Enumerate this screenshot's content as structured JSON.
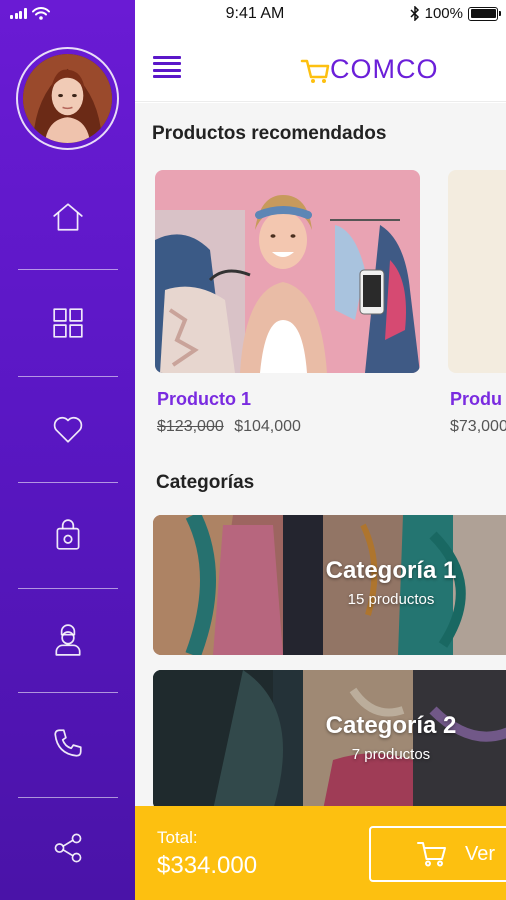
{
  "status_bar": {
    "time": "9:41 AM",
    "battery": "100%",
    "battery_level": 1.0
  },
  "sidebar": {
    "items": [
      {
        "icon": "home-icon"
      },
      {
        "icon": "grid-icon"
      },
      {
        "icon": "heart-icon"
      },
      {
        "icon": "shopping-bag-icon"
      },
      {
        "icon": "user-icon"
      },
      {
        "icon": "phone-icon"
      },
      {
        "icon": "share-icon"
      }
    ]
  },
  "header": {
    "logo": "COMCO",
    "menu_icon": "hamburger-menu-icon"
  },
  "recommended": {
    "title": "Productos recomendados",
    "products": [
      {
        "name": "Producto 1",
        "old_price": "$123,000",
        "price": "$104,000"
      },
      {
        "name": "Produ",
        "price": "$73,000"
      }
    ]
  },
  "categories": {
    "title": "Categorías",
    "items": [
      {
        "name": "Categoría 1",
        "count": "15 productos"
      },
      {
        "name": "Categoría 2",
        "count": "7 productos"
      }
    ]
  },
  "footer": {
    "total_label": "Total:",
    "total_value": "$334.000",
    "button_label": "Ver"
  },
  "colors": {
    "primary": "#6a1bd4",
    "accent": "#fdc010",
    "product_name": "#7a2be0"
  }
}
